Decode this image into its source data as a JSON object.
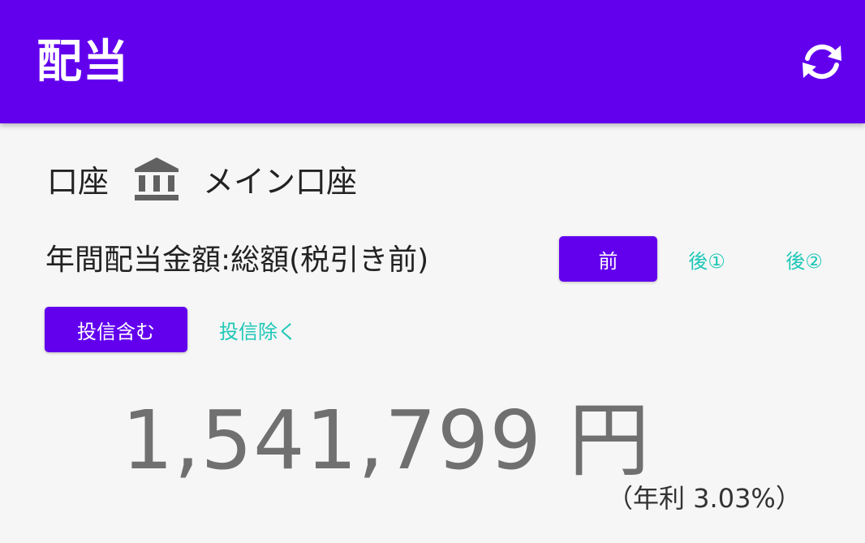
{
  "appbar": {
    "title": "配当",
    "refresh_icon": "refresh-icon",
    "bg_color": "#6200ee"
  },
  "account": {
    "label": "口座",
    "icon": "bank-icon",
    "name": "メイン口座"
  },
  "annual_dividend": {
    "label": "年間配当金額:総額(税引き前)",
    "tax_options": [
      {
        "label": "前",
        "selected": true
      },
      {
        "label": "後①",
        "selected": false
      },
      {
        "label": "後②",
        "selected": false
      }
    ],
    "fund_options": [
      {
        "label": "投信含む",
        "selected": true
      },
      {
        "label": "投信除く",
        "selected": false
      }
    ],
    "amount": "1,541,799 円",
    "yield": "（年利 3.03%）"
  },
  "colors": {
    "accent": "#6200ee",
    "inactive_text": "#1ec8b8",
    "amount_text": "#707070"
  }
}
